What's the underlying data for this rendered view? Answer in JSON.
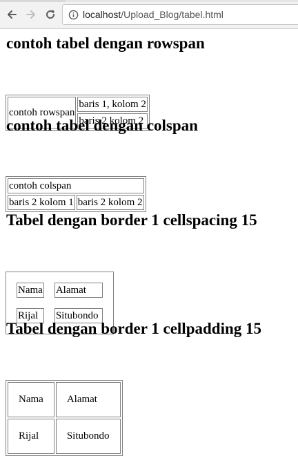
{
  "browser": {
    "url_host": "localhost",
    "url_path": "/Upload_Blog/tabel.html",
    "icons": {
      "back": "arrow-left-icon",
      "forward": "arrow-right-icon",
      "reload": "reload-icon",
      "info": "info-icon"
    }
  },
  "section1": {
    "heading": "contoh tabel dengan rowspan",
    "rowspan_cell": "contoh rowspan",
    "row1_cell": "baris 1, kolom 2",
    "row2_cell": "baris 2 kolom 2"
  },
  "section2": {
    "heading": "contoh tabel dengan colspan",
    "colspan_cell": "contoh colspan",
    "row2_col1": "baris 2 kolom 1",
    "row2_col2": "baris 2 kolom 2"
  },
  "section3": {
    "heading": "Tabel dengan border 1 cellspacing 15",
    "header": [
      "Nama",
      "Alamat"
    ],
    "row": [
      "Rijal",
      "Situbondo"
    ]
  },
  "section4": {
    "heading": "Tabel dengan border 1 cellpadding 15",
    "header": [
      "Nama",
      "Alamat"
    ],
    "row": [
      "Rijal",
      "Situbondo"
    ]
  }
}
